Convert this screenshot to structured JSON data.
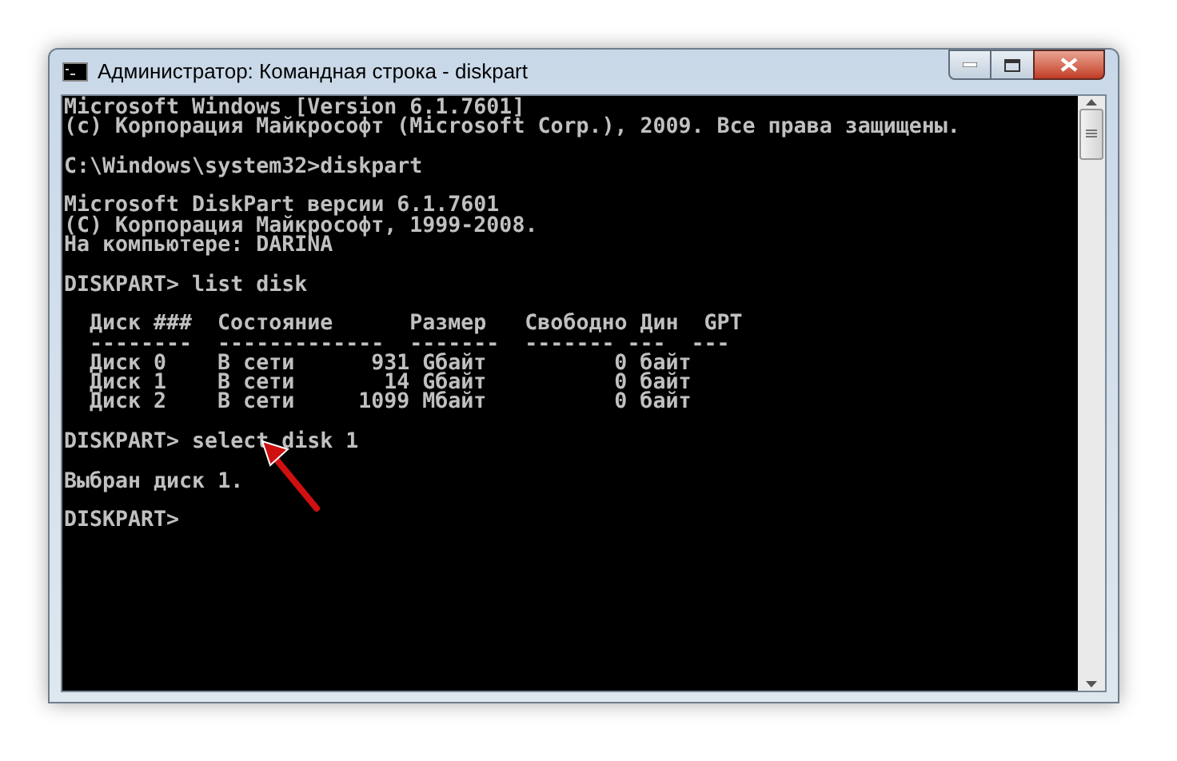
{
  "window": {
    "title": "Администратор: Командная строка - diskpart"
  },
  "console": {
    "blocks": [
      [
        "Microsoft Windows [Version 6.1.7601]",
        "(c) Корпорация Майкрософт (Microsoft Corp.), 2009. Все права защищены."
      ],
      [
        "C:\\Windows\\system32>diskpart"
      ],
      [
        "Microsoft DiskPart версии 6.1.7601",
        "(C) Корпорация Майкрософт, 1999-2008.",
        "На компьютере: DARINA"
      ],
      [
        "DISKPART> list disk"
      ]
    ],
    "table": {
      "columns": [
        "Диск ###",
        "Состояние",
        "Размер",
        "Свободно",
        "Дин",
        "GPT"
      ],
      "separators": [
        "--------",
        "-------------",
        "-------",
        "-------",
        "---",
        "---"
      ],
      "rows": [
        [
          "Диск 0",
          "В сети",
          "931 Gбайт",
          "0 байт"
        ],
        [
          "Диск 1",
          "В сети",
          "14 Gбайт",
          "0 байт"
        ],
        [
          "Диск 2",
          "В сети",
          "1099 Мбайт",
          "0 байт"
        ]
      ]
    },
    "after": [
      [
        "DISKPART> select disk 1"
      ],
      [
        "Выбран диск 1."
      ],
      [
        "DISKPART>"
      ]
    ]
  }
}
